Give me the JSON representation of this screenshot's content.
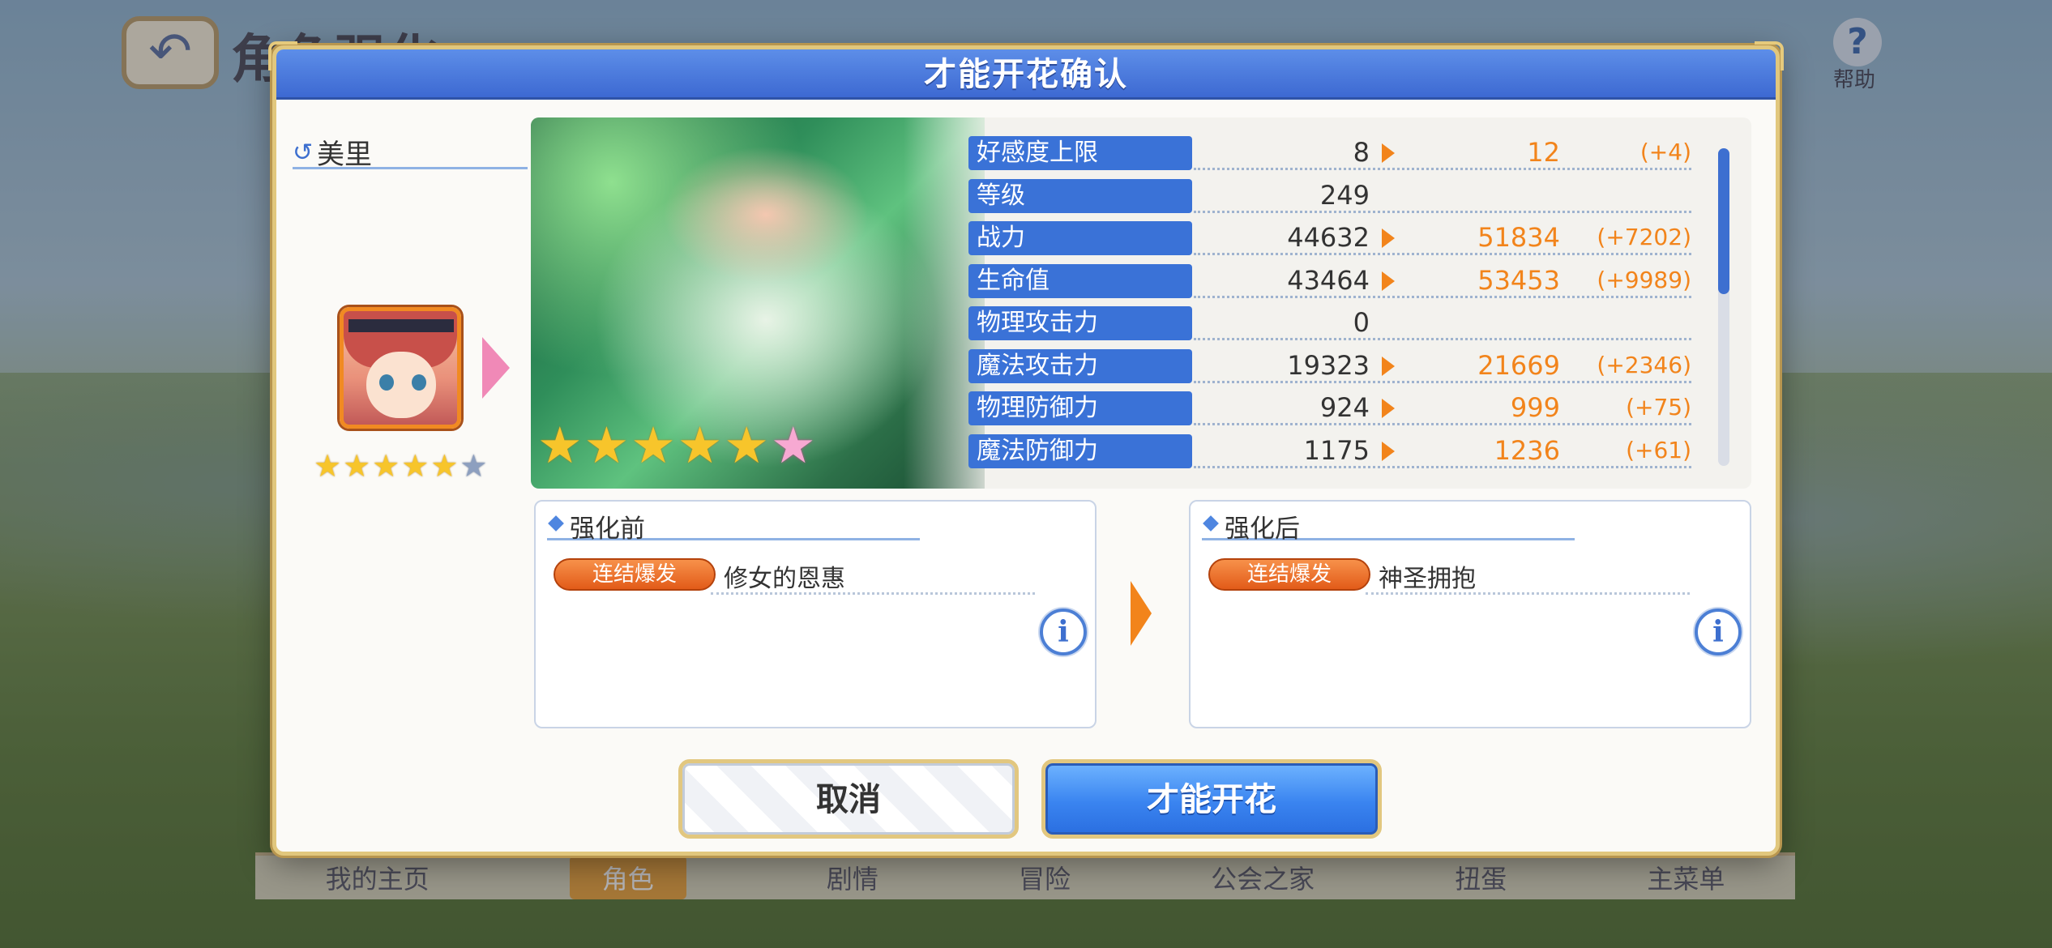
{
  "background": {
    "title": "角色强化",
    "help_label": "帮助",
    "nav": [
      "我的主页",
      "角色",
      "剧情",
      "冒险",
      "公会之家",
      "扭蛋",
      "主菜单"
    ]
  },
  "dialog": {
    "title": "才能开花确认",
    "character_name": "美里",
    "portrait_stars": 5,
    "portrait_stars_max": 6,
    "art_stars": 6,
    "stats": [
      {
        "label": "好感度上限",
        "before": "8",
        "after": "12",
        "diff": "(+4)"
      },
      {
        "label": "等级",
        "before": "249",
        "after": "",
        "diff": ""
      },
      {
        "label": "战力",
        "before": "44632",
        "after": "51834",
        "diff": "(+7202)"
      },
      {
        "label": "生命值",
        "before": "43464",
        "after": "53453",
        "diff": "(+9989)"
      },
      {
        "label": "物理攻击力",
        "before": "0",
        "after": "",
        "diff": ""
      },
      {
        "label": "魔法攻击力",
        "before": "19323",
        "after": "21669",
        "diff": "(+2346)"
      },
      {
        "label": "物理防御力",
        "before": "924",
        "after": "999",
        "diff": "(+75)"
      },
      {
        "label": "魔法防御力",
        "before": "1175",
        "after": "1236",
        "diff": "(+61)"
      }
    ],
    "skill_before": {
      "title": "强化前",
      "badge": "连结爆发",
      "name": "修女的恩惠"
    },
    "skill_after": {
      "title": "强化后",
      "badge": "连结爆发",
      "name": "神圣拥抱"
    },
    "cancel_label": "取消",
    "confirm_label": "才能开花"
  },
  "colors": {
    "header_blue": "#3d69d2",
    "stat_label_blue": "#3a72d7",
    "increase_orange": "#f2841b",
    "badge_orange": "#e25b19"
  }
}
